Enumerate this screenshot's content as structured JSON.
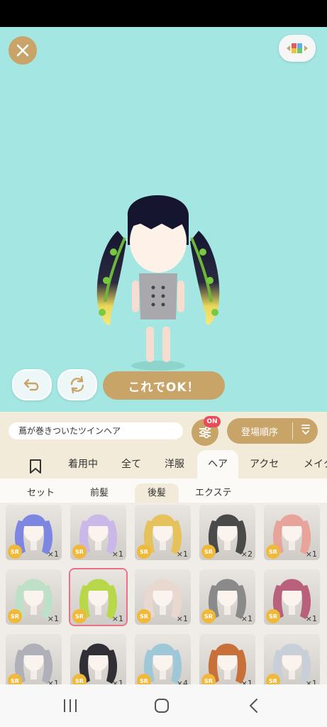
{
  "status_bar": {
    "visible": true
  },
  "top": {
    "close_icon": "close-icon",
    "palette_icon": "palette-icon"
  },
  "controls": {
    "undo_icon": "undo-icon",
    "rotate_icon": "rotate-icon",
    "ok_label": "これでOK！"
  },
  "item_bar": {
    "item_name": "蔦が巻きついたツインヘア",
    "filter_badge": "ON",
    "sort_label": "登場順序",
    "sort_icon": "sort-icon"
  },
  "tabs": [
    {
      "label": "",
      "icon": "bookmark-icon"
    },
    {
      "label": "着用中"
    },
    {
      "label": "全て"
    },
    {
      "label": "洋服"
    },
    {
      "label": "ヘア",
      "active": true
    },
    {
      "label": "アクセ"
    },
    {
      "label": "メイク"
    }
  ],
  "subtabs": [
    {
      "label": "セット"
    },
    {
      "label": "前髪"
    },
    {
      "label": "後髪",
      "active": true
    },
    {
      "label": "エクステ"
    }
  ],
  "items": [
    {
      "rarity": "SR",
      "count": "×1",
      "color": "#7d86e0"
    },
    {
      "rarity": "SR",
      "count": "×1",
      "color": "#c9b8e8"
    },
    {
      "rarity": "SR",
      "count": "×1",
      "color": "#e6c35a"
    },
    {
      "rarity": "SR",
      "count": "×2",
      "color": "#4a4a4a"
    },
    {
      "rarity": "SR",
      "count": "×1",
      "color": "#e8a49a"
    },
    {
      "rarity": "SR",
      "count": "×1",
      "color": "#bfe0c8"
    },
    {
      "rarity": "SR",
      "count": "×1",
      "color": "#b8d84a",
      "selected": true
    },
    {
      "rarity": "SR",
      "count": "×1",
      "color": "#e9d8cf"
    },
    {
      "rarity": "SR",
      "count": "×1",
      "color": "#8a8a8a"
    },
    {
      "rarity": "SR",
      "count": "×1",
      "color": "#b8607c"
    },
    {
      "rarity": "SR",
      "count": "×1",
      "color": "#b0b0b8"
    },
    {
      "rarity": "SR",
      "count": "×1",
      "color": "#2f2f35"
    },
    {
      "rarity": "SR",
      "count": "×4",
      "color": "#9ec8d8"
    },
    {
      "rarity": "SR",
      "count": "×1",
      "color": "#c8703a"
    },
    {
      "rarity": "SR",
      "count": "×1",
      "color": "#c8cfd8"
    }
  ],
  "navbar": {
    "recent_icon": "recent-apps-icon",
    "home_icon": "home-icon",
    "back_icon": "back-icon"
  },
  "colors": {
    "accent": "#c8a468",
    "stage_bg": "#a3e6e2",
    "badge": "#e84c58",
    "selected": "#ec6f88",
    "rarity": "#f0b93a"
  }
}
